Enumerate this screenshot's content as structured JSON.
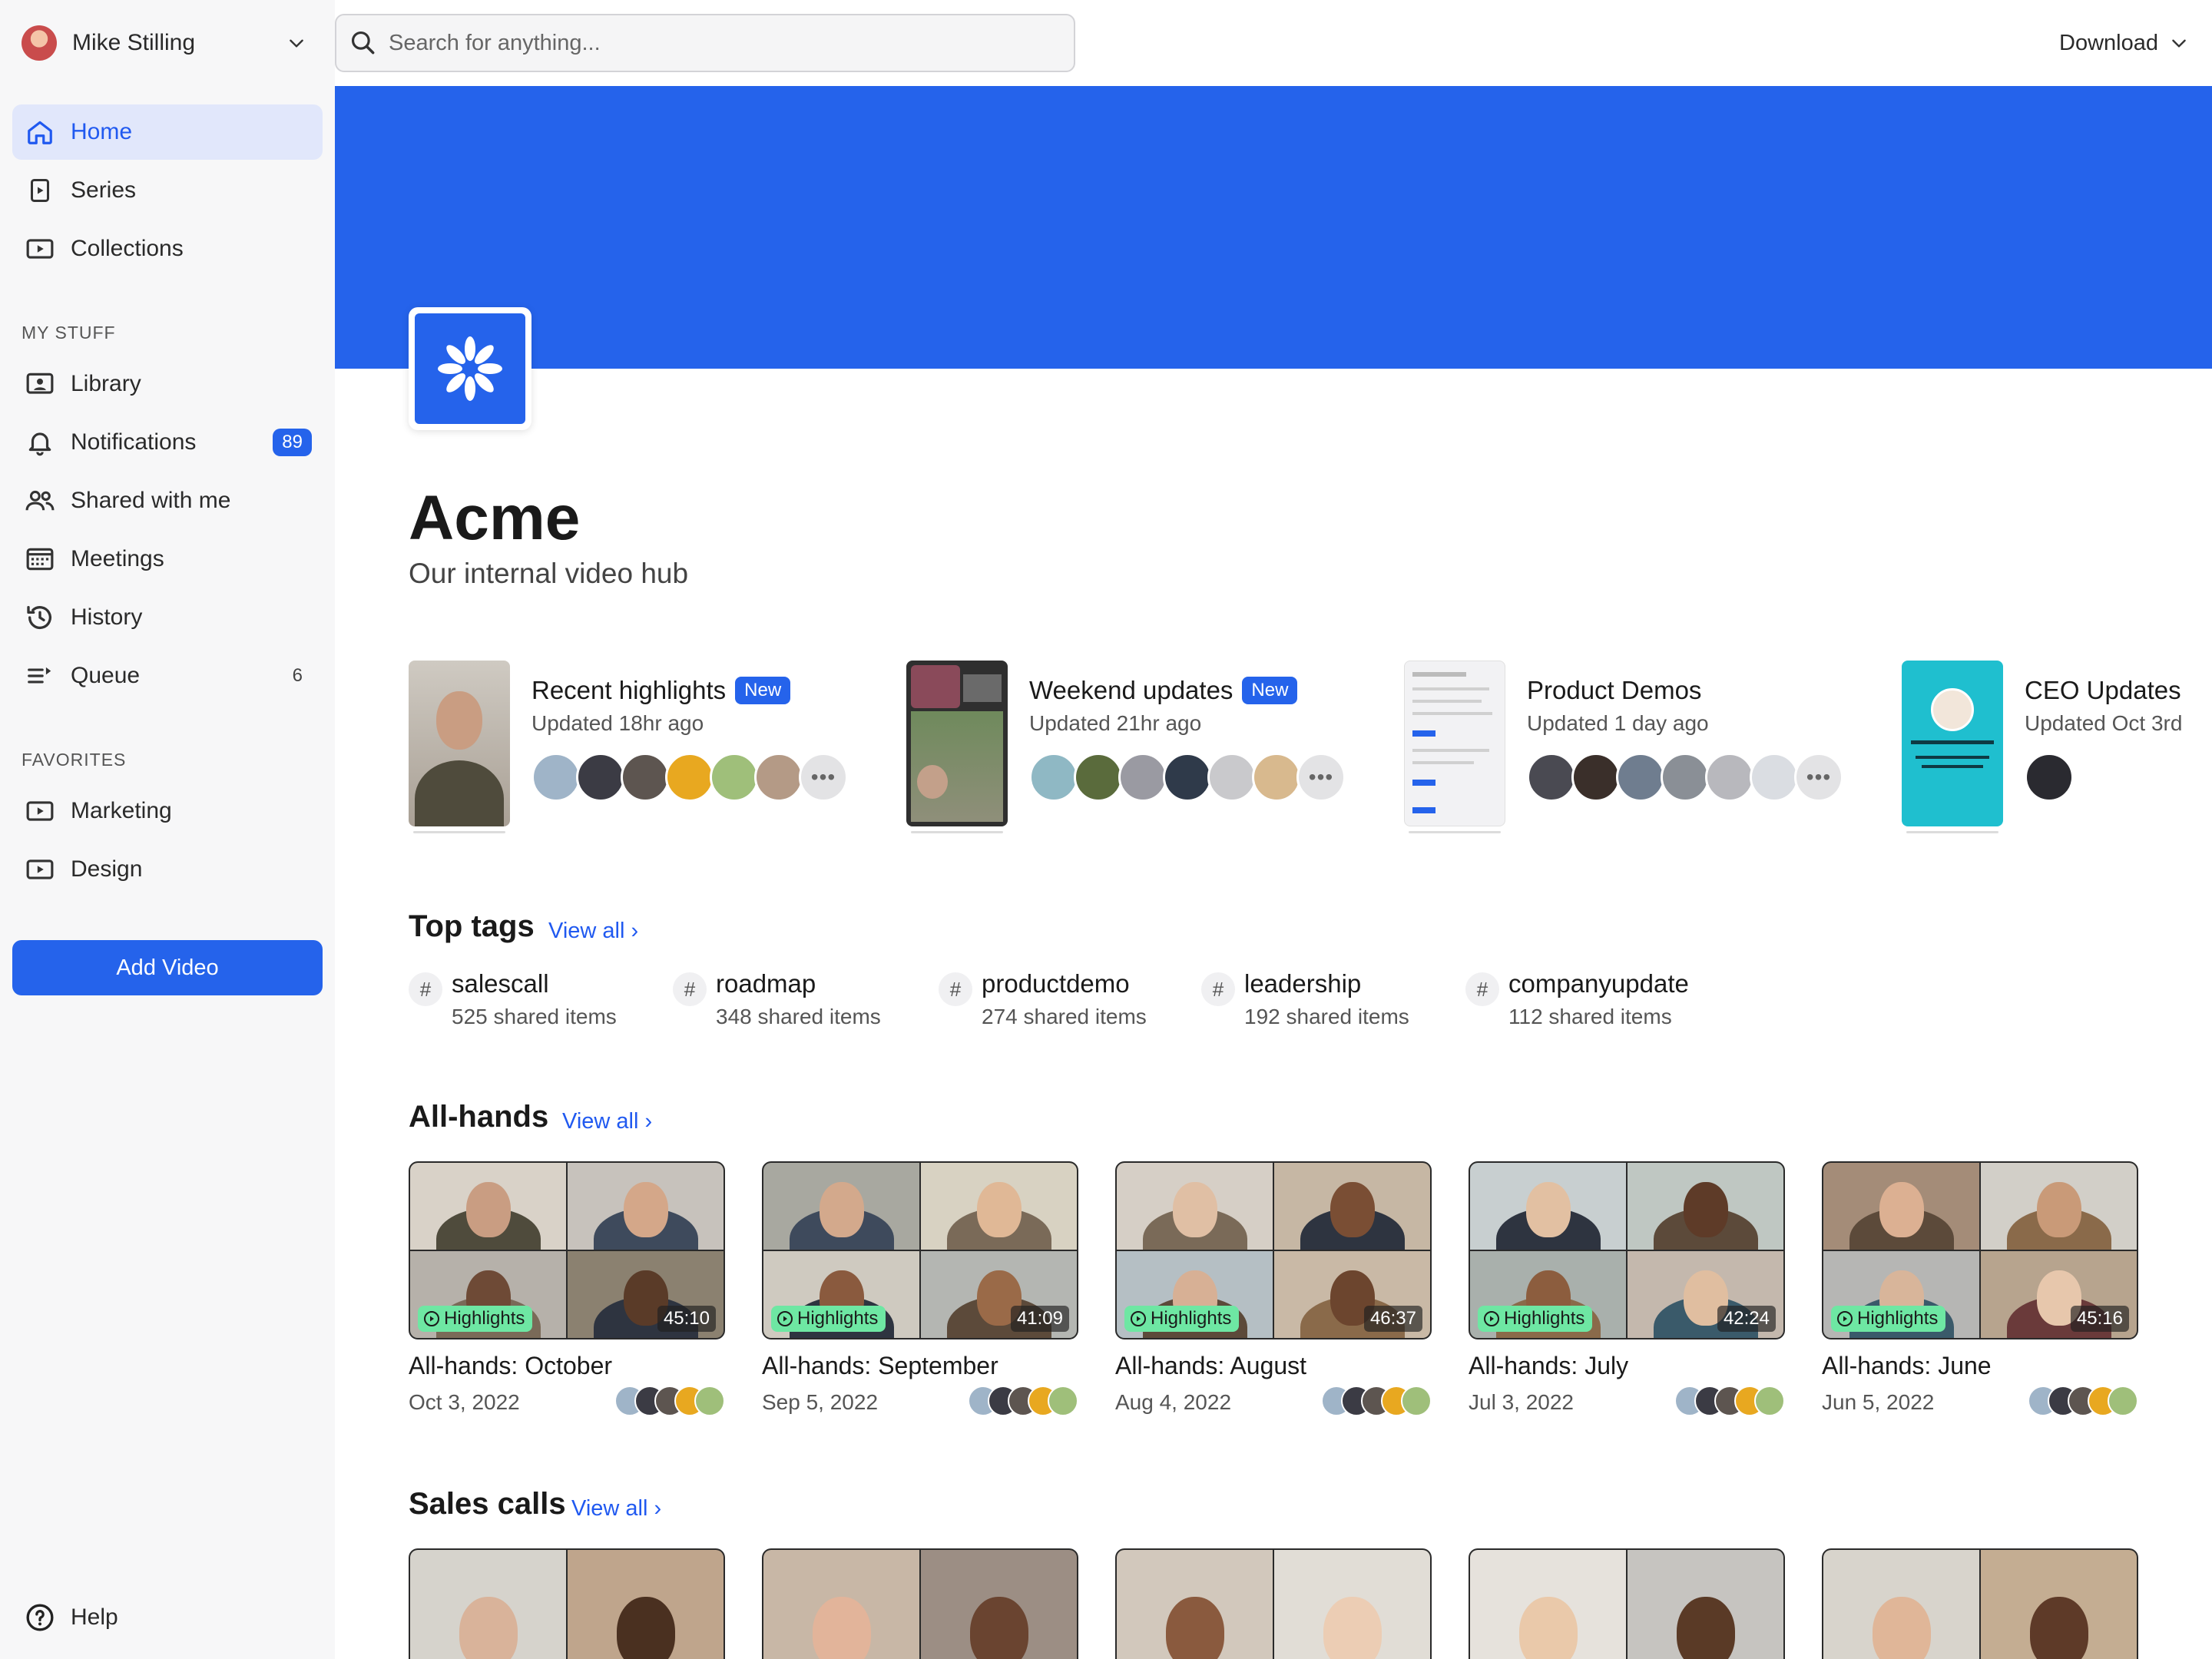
{
  "user": {
    "name": "Mike Stilling"
  },
  "search": {
    "placeholder": "Search for anything..."
  },
  "topbar": {
    "download_label": "Download"
  },
  "nav": {
    "main": [
      {
        "label": "Home",
        "icon": "home-icon",
        "active": true
      },
      {
        "label": "Series",
        "icon": "series-icon"
      },
      {
        "label": "Collections",
        "icon": "collections-icon"
      }
    ],
    "my_stuff_label": "MY STUFF",
    "my_stuff": [
      {
        "label": "Library",
        "icon": "library-icon"
      },
      {
        "label": "Notifications",
        "icon": "bell-icon",
        "badge": "89"
      },
      {
        "label": "Shared with me",
        "icon": "people-icon"
      },
      {
        "label": "Meetings",
        "icon": "calendar-icon"
      },
      {
        "label": "History",
        "icon": "history-icon"
      },
      {
        "label": "Queue",
        "icon": "queue-icon",
        "count": "6"
      }
    ],
    "favorites_label": "FAVORITES",
    "favorites": [
      {
        "label": "Marketing",
        "icon": "video-folder-icon"
      },
      {
        "label": "Design",
        "icon": "video-folder-icon"
      }
    ],
    "add_video_label": "Add Video",
    "help_label": "Help"
  },
  "hub": {
    "title": "Acme",
    "subtitle": "Our internal video hub"
  },
  "series": [
    {
      "name": "Recent highlights",
      "badge": "New",
      "updated": "Updated 18hr ago"
    },
    {
      "name": "Weekend updates",
      "badge": "New",
      "updated": "Updated 21hr ago"
    },
    {
      "name": "Product Demos",
      "updated": "Updated 1 day ago"
    },
    {
      "name": "CEO Updates",
      "updated": "Updated Oct 3rd"
    }
  ],
  "top_tags": {
    "heading": "Top tags",
    "view_all": "View all",
    "items": [
      {
        "name": "salescall",
        "count": "525 shared items"
      },
      {
        "name": "roadmap",
        "count": "348 shared items"
      },
      {
        "name": "productdemo",
        "count": "274 shared items"
      },
      {
        "name": "leadership",
        "count": "192 shared items"
      },
      {
        "name": "companyupdate",
        "count": "112 shared items"
      }
    ]
  },
  "all_hands": {
    "heading": "All-hands",
    "view_all": "View all",
    "badge_label": "Highlights",
    "videos": [
      {
        "title": "All-hands: October",
        "date": "Oct 3, 2022",
        "duration": "45:10"
      },
      {
        "title": "All-hands: September",
        "date": "Sep 5, 2022",
        "duration": "41:09"
      },
      {
        "title": "All-hands: August",
        "date": "Aug 4, 2022",
        "duration": "46:37"
      },
      {
        "title": "All-hands: July",
        "date": "Jul 3, 2022",
        "duration": "42:24"
      },
      {
        "title": "All-hands: June",
        "date": "Jun 5, 2022",
        "duration": "45:16"
      }
    ]
  },
  "sales_calls": {
    "heading": "Sales calls",
    "view_all": "View all"
  },
  "colors": {
    "accent": "#2563eb",
    "highlight_badge": "#6ee7a3",
    "sidebar_bg": "#f7f7f8",
    "active_nav_bg": "#e1e7fb"
  }
}
